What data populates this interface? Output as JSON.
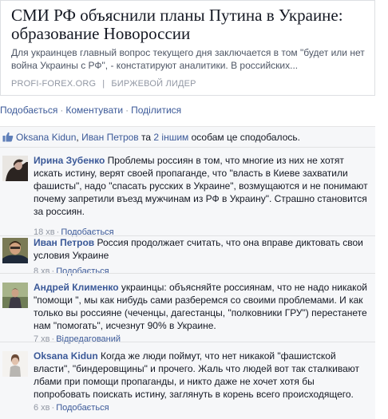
{
  "card": {
    "title": "СМИ РФ объяснили планы Путина в Украине: образование Новороссии",
    "description": "Для украинцев главный вопрос текущего дня заключается в том \"будет или нет война Украины с РФ\", - констатируют аналитики. В российских...",
    "source_domain": "PROFI-FOREX.ORG",
    "source_separator": "|",
    "source_name": "БИРЖЕВОЙ ЛИДЕР"
  },
  "actions": {
    "like": "Подобається",
    "comment": "Коментувати",
    "share": "Поділитися",
    "separator": "·"
  },
  "likes": {
    "name1": "Oksana Kidun",
    "sep": ", ",
    "name2": "Иван Петров",
    "and": " та ",
    "others": "2 іншим",
    "tail": " особам це сподобалось."
  },
  "comments": [
    {
      "author": "Ирина Зубенко",
      "text": "Проблемы россиян в том, что многие из них не хотят искать истину, верят своей пропаганде, что \"власть в Киеве захватили фашисты\", надо \"спасать русских в Украине\", возмущаются и не понимают почему запретили въезд мужчинам из РФ в Украину\". Страшно становится за россиян.",
      "time": "18 хв",
      "like": "Подобається",
      "dot": "·"
    },
    {
      "author": "Иван Петров",
      "text": "Россия продолжает считать, что она вправе диктовать свои условия Украине",
      "time": "8 хв",
      "like": "Подобається",
      "dot": "·"
    },
    {
      "author": "Андрей Клименко",
      "text": "украинцы: объясняйте россиянам, что не надо никакой \"помощи \", мы как нибудь сами разберемся со своими проблемами. И как только вы россияне (чеченцы, дагестанцы, \"полковники ГРУ\") перестанете нам \"помогать\", исчезнут 90% в Украине.",
      "time": "7 хв",
      "like": "Відредагований",
      "dot": "·"
    },
    {
      "author": "Oksana Kidun",
      "text": "Когда же люди поймут, что нет никакой \"фашистской власти\", \"биндеровщины\" и прочего. Жаль что людей вот так сталкивают лбами при помощи пропаганды, и никто даже не хочет хотя бы попробовать поискать истину, заглянуть в корень всего происходящего.",
      "time": "6 хв",
      "like": "Подобається",
      "dot": "·"
    }
  ]
}
